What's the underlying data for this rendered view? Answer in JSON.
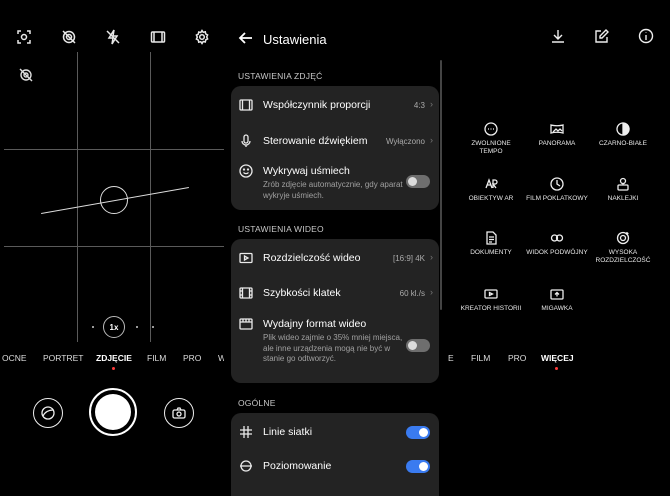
{
  "camera": {
    "top_icons": [
      "ai-camera-icon",
      "live-photo-off-icon",
      "flash-off-icon",
      "aspect-ratio-icon",
      "settings-gear-icon"
    ],
    "zoom": "1x",
    "modes": [
      "OCNE",
      "PORTRET",
      "ZDJĘCIE",
      "FILM",
      "PRO",
      "W"
    ],
    "active_mode": "ZDJĘCIE"
  },
  "settings": {
    "title": "Ustawienia",
    "photo_section": {
      "title": "USTAWIENIA ZDJĘĆ",
      "aspect": {
        "label": "Współczynnik proporcji",
        "value": "4:3"
      },
      "sound": {
        "label": "Sterowanie dźwiękiem",
        "value": "Wyłączono"
      },
      "smile": {
        "label": "Wykrywaj uśmiech",
        "desc": "Zrób zdjęcie automatycznie, gdy aparat wykryje uśmiech.",
        "enabled": false
      }
    },
    "video_section": {
      "title": "USTAWIENIA WIDEO",
      "resolution": {
        "label": "Rozdzielczość wideo",
        "value": "[16:9] 4K"
      },
      "framerate": {
        "label": "Szybkości klatek",
        "value": "60 kl./s"
      },
      "efficient": {
        "label": "Wydajny format wideo",
        "desc": "Plik wideo zajmie o 35% mniej miejsca, ale inne urządzenia mogą nie być w stanie go odtworzyć.",
        "enabled": false
      }
    },
    "general_section": {
      "title": "OGÓLNE",
      "grid": {
        "label": "Linie siatki",
        "enabled": true
      },
      "level": {
        "label": "Poziomowanie",
        "enabled": true
      }
    }
  },
  "more": {
    "tiles": [
      {
        "label": "ZWOLNIONE TEMPO",
        "icon": "slow-motion-icon"
      },
      {
        "label": "PANORAMA",
        "icon": "panorama-icon"
      },
      {
        "label": "CZARNO-BIAŁE",
        "icon": "black-white-icon"
      },
      {
        "label": "OBIEKTYW AR",
        "icon": "ar-lens-icon"
      },
      {
        "label": "FILM POKLATKOWY",
        "icon": "timelapse-icon"
      },
      {
        "label": "NAKLEJKI",
        "icon": "stickers-icon"
      },
      {
        "label": "DOKUMENTY",
        "icon": "documents-icon"
      },
      {
        "label": "WIDOK PODWÓJNY",
        "icon": "dual-view-icon"
      },
      {
        "label": "WYSOKA ROZDZIELCZOŚĆ",
        "icon": "high-res-icon"
      },
      {
        "label": "KREATOR HISTORII",
        "icon": "story-creator-icon"
      },
      {
        "label": "MIGAWKA",
        "icon": "snapshot-icon"
      }
    ],
    "modes": [
      "E",
      "FILM",
      "PRO",
      "WIĘCEJ"
    ],
    "active_mode": "WIĘCEJ"
  }
}
